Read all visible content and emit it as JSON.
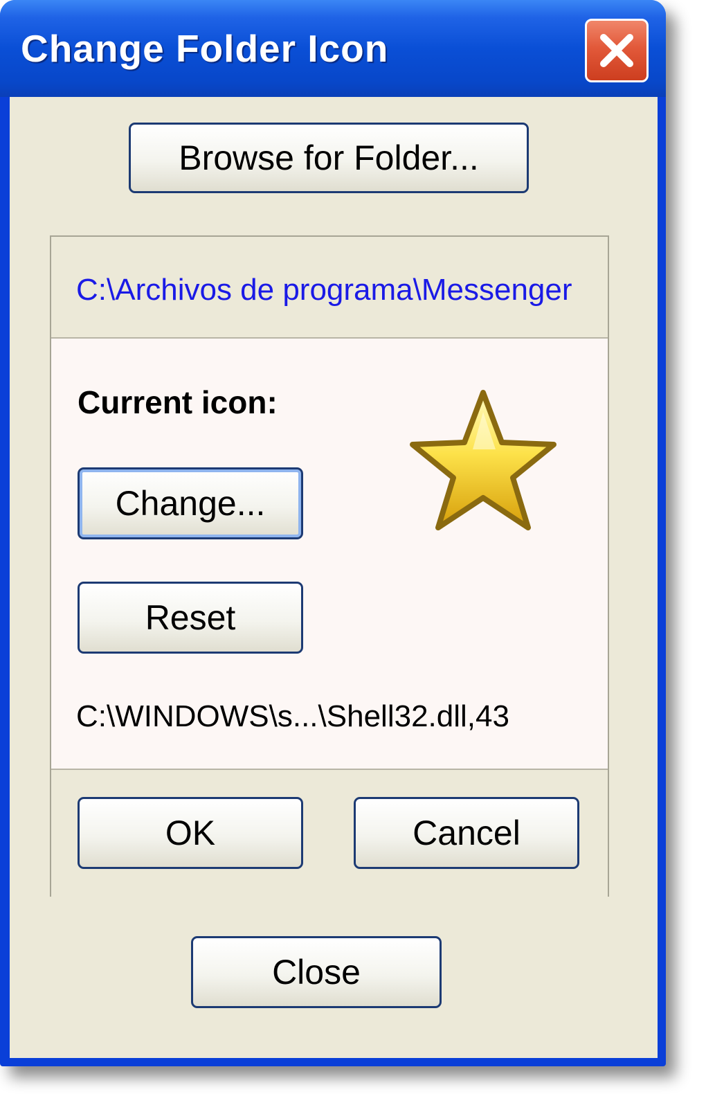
{
  "window": {
    "title": "Change Folder Icon"
  },
  "buttons": {
    "browse_label": "Browse for Folder...",
    "change_label": "Change...",
    "reset_label": "Reset",
    "ok_label": "OK",
    "cancel_label": "Cancel",
    "close_label": "Close"
  },
  "folder": {
    "path": "C:\\Archivos de programa\\Messenger"
  },
  "icon": {
    "label": "Current icon:",
    "source": "C:\\WINDOWS\\s...\\Shell32.dll,43",
    "semantic": "star-icon"
  },
  "colors": {
    "title_bar": "#0a4fd6",
    "close_button": "#e2593a",
    "path_text": "#1a1ae6",
    "face": "#ece9d8"
  }
}
